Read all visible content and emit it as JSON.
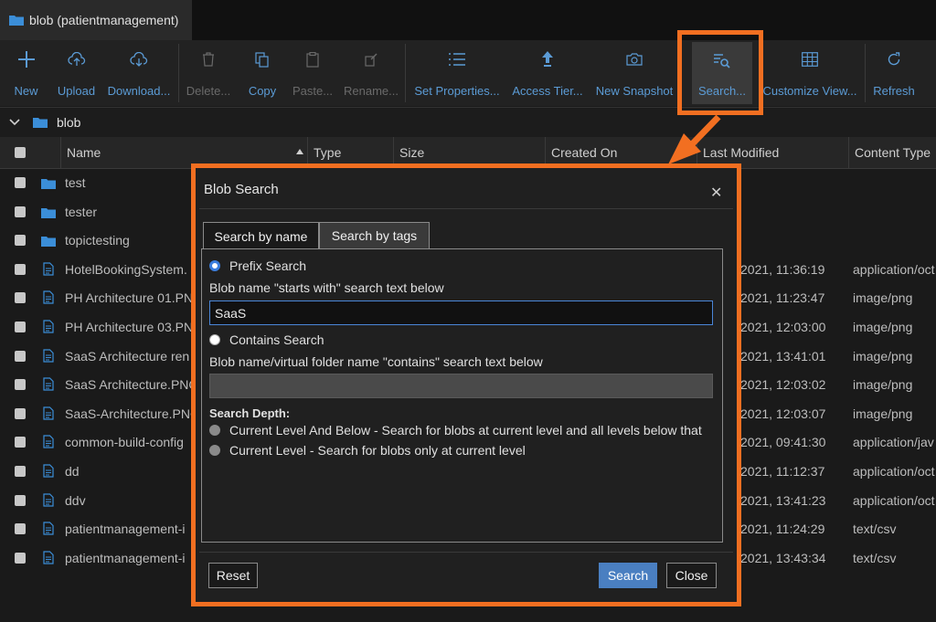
{
  "tab": {
    "title": "blob (patientmanagement)"
  },
  "toolbar": {
    "new": "New",
    "upload": "Upload",
    "download": "Download...",
    "delete": "Delete...",
    "copy": "Copy",
    "paste": "Paste...",
    "rename": "Rename...",
    "set_properties": "Set Properties...",
    "access_tier": "Access Tier...",
    "new_snapshot": "New Snapshot",
    "search": "Search...",
    "customize_view": "Customize View...",
    "refresh": "Refresh"
  },
  "path": {
    "folder": "blob"
  },
  "columns": {
    "name": "Name",
    "type": "Type",
    "size": "Size",
    "created_on": "Created On",
    "last_modified": "Last Modified",
    "content_type": "Content Type"
  },
  "rows": [
    {
      "name": "test",
      "kind": "folder",
      "modified": "",
      "content_type": ""
    },
    {
      "name": "tester",
      "kind": "folder",
      "modified": "",
      "content_type": ""
    },
    {
      "name": "topictesting",
      "kind": "folder",
      "modified": "",
      "content_type": ""
    },
    {
      "name": "HotelBookingSystem.",
      "kind": "file",
      "modified": "2021, 11:36:19",
      "content_type": "application/oct"
    },
    {
      "name": "PH Architecture 01.PN",
      "kind": "file",
      "modified": "2021, 11:23:47",
      "content_type": "image/png"
    },
    {
      "name": "PH Architecture 03.PN",
      "kind": "file",
      "modified": "2021, 12:03:00",
      "content_type": "image/png"
    },
    {
      "name": "SaaS Architecture ren",
      "kind": "file",
      "modified": "2021, 13:41:01",
      "content_type": "image/png"
    },
    {
      "name": "SaaS Architecture.PNG",
      "kind": "file",
      "modified": "2021, 12:03:02",
      "content_type": "image/png"
    },
    {
      "name": "SaaS-Architecture.PNG",
      "kind": "file",
      "modified": "2021, 12:03:07",
      "content_type": "image/png"
    },
    {
      "name": "common-build-config",
      "kind": "file",
      "modified": "2021, 09:41:30",
      "content_type": "application/jav"
    },
    {
      "name": "dd",
      "kind": "file",
      "modified": "2021, 11:12:37",
      "content_type": "application/oct"
    },
    {
      "name": "ddv",
      "kind": "file",
      "modified": "2021, 13:41:23",
      "content_type": "application/oct"
    },
    {
      "name": "patientmanagement-i",
      "kind": "file",
      "modified": "2021, 11:24:29",
      "content_type": "text/csv"
    },
    {
      "name": "patientmanagement-i",
      "kind": "file",
      "modified": "2021, 13:43:34",
      "content_type": "text/csv"
    }
  ],
  "dialog": {
    "title": "Blob Search",
    "tab_by_name": "Search by name",
    "tab_by_tags": "Search by tags",
    "prefix_label": "Prefix Search",
    "prefix_desc": "Blob name \"starts with\" search text below",
    "prefix_value": "SaaS",
    "contains_label": "Contains Search",
    "contains_desc": "Blob name/virtual folder name \"contains\" search text below",
    "contains_value": "",
    "depth_heading": "Search Depth:",
    "depth_below": "Current Level And Below - Search for blobs at current level and all levels below that",
    "depth_current": "Current Level - Search for blobs only at current level",
    "reset": "Reset",
    "search": "Search",
    "close": "Close"
  },
  "colors": {
    "accent": "#5b9bd5",
    "highlight": "#f26f21",
    "primary_button": "#4a7fc1"
  }
}
